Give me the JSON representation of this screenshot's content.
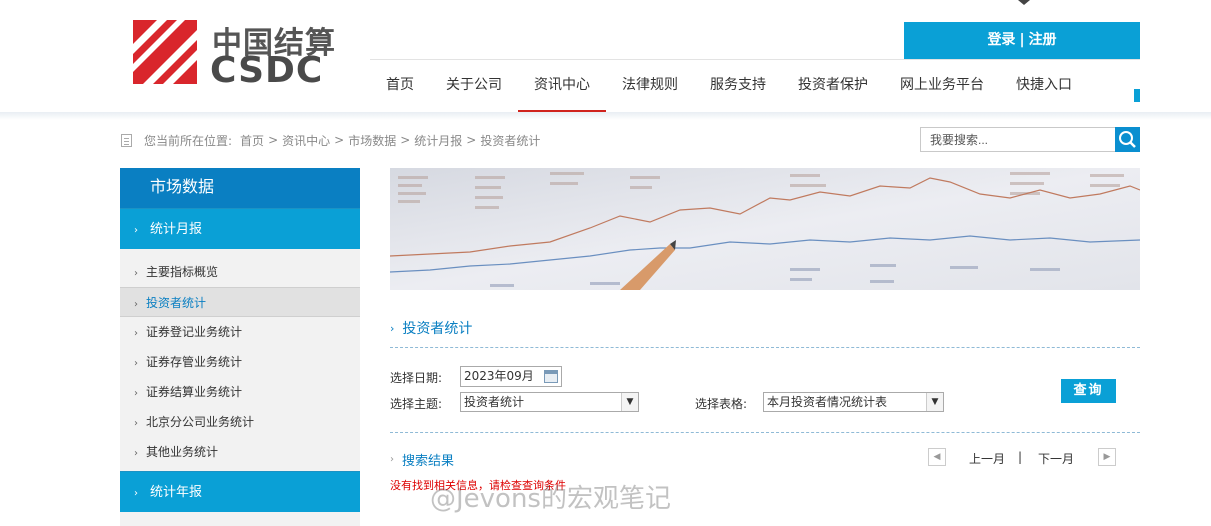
{
  "header": {
    "logo_cn": "中国结算",
    "logo_en": "CSDC",
    "login": "登录",
    "login_sep": "|",
    "register": "注册",
    "nav": [
      "首页",
      "关于公司",
      "资讯中心",
      "法律规则",
      "服务支持",
      "投资者保护",
      "网上业务平台",
      "快捷入口"
    ],
    "nav_active_index": 2
  },
  "breadcrumb": {
    "prefix": "您当前所在位置:",
    "items": [
      "首页",
      "资讯中心",
      "市场数据",
      "统计月报",
      "投资者统计"
    ],
    "separator": ">"
  },
  "search": {
    "placeholder": "我要搜索..."
  },
  "sidebar": {
    "title": "市场数据",
    "category": "统计月报",
    "items": [
      "主要指标概览",
      "投资者统计",
      "证券登记业务统计",
      "证券存管业务统计",
      "证券结算业务统计",
      "北京分公司业务统计",
      "其他业务统计"
    ],
    "active_index": 1,
    "category_bottom": "统计年报"
  },
  "content": {
    "section_title": "投资者统计",
    "date_label": "选择日期:",
    "date_value": "2023年09月",
    "topic_label": "选择主题:",
    "topic_value": "投资者统计",
    "table_label": "选择表格:",
    "table_value": "本月投资者情况统计表",
    "query_button": "查询",
    "results_title": "搜索结果",
    "prev_month": "上一月",
    "pager_sep": "|",
    "next_month": "下一月",
    "no_result": "没有找到相关信息，请检查查询条件"
  },
  "watermark": "@Jevons的宏观笔记",
  "colors": {
    "brand_blue": "#0aa0d6",
    "dark_blue": "#0a7fc2",
    "active_red": "#d0231d",
    "logo_red": "#d9262c"
  }
}
